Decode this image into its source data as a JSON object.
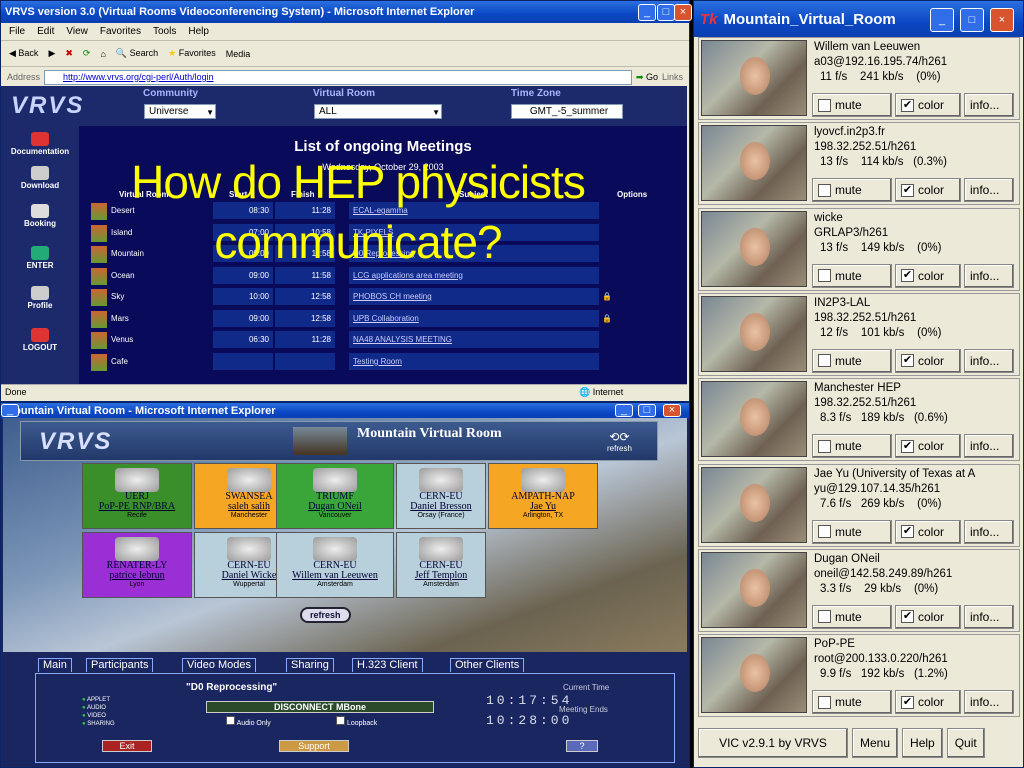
{
  "browser1": {
    "title": "VRVS version 3.0 (Virtual Rooms Videoconferencing System) - Microsoft Internet Explorer",
    "menu": [
      "File",
      "Edit",
      "View",
      "Favorites",
      "Tools",
      "Help"
    ],
    "toolbar": [
      "Back",
      "Search",
      "Favorites",
      "Media"
    ],
    "address_label": "Address",
    "url": "http://www.vrvs.org/cgi-perl/Auth/login",
    "go": "Go",
    "links": "Links",
    "status_left": "Done",
    "status_right": "Internet"
  },
  "vrvs_header": {
    "logo": "VRVS",
    "community_label": "Community",
    "community_value": "Universe",
    "vroom_label": "Virtual Room",
    "vroom_value": "ALL",
    "tz_label": "Time Zone",
    "tz_value": "GMT_-5_summer"
  },
  "sidebar": [
    "Documentation",
    "Download",
    "Booking",
    "ENTER",
    "Profile",
    "LOGOUT"
  ],
  "meetings": {
    "title": "List of ongoing Meetings",
    "date": "Wednesday, October 29, 2003",
    "headers": [
      "Virtual Room",
      "Start",
      "Finish",
      "Subject",
      "Options"
    ],
    "rows": [
      {
        "room": "Desert",
        "start": "08:30",
        "finish": "11:28",
        "subject": "ECAL-egamma"
      },
      {
        "room": "Island",
        "start": "07:00",
        "finish": "10:58",
        "subject": "TK PIXELS"
      },
      {
        "room": "Mountain",
        "start": "09:00",
        "finish": "11:58",
        "subject": "D0 Reprocessing"
      },
      {
        "room": "Ocean",
        "start": "09:00",
        "finish": "11:58",
        "subject": "LCG applications area meeting"
      },
      {
        "room": "Sky",
        "start": "10:00",
        "finish": "12:58",
        "subject": "PHOBOS CH meeting"
      },
      {
        "room": "Mars",
        "start": "09:00",
        "finish": "12:58",
        "subject": "UPB Collaboration"
      },
      {
        "room": "Venus",
        "start": "06:30",
        "finish": "11:28",
        "subject": "NA48 ANALYSIS MEETING"
      },
      {
        "room": "Cafe",
        "start": "",
        "finish": "",
        "subject": "Testing Room"
      }
    ]
  },
  "overlay_text": [
    "How do HEP physicists",
    "communicate?"
  ],
  "browser2": {
    "title": "Mountain Virtual Room - Microsoft Internet Explorer",
    "logo": "VRVS",
    "room_title": "Mountain Virtual Room",
    "refresh": "refresh",
    "sites": [
      {
        "name": "UERJ",
        "sub1": "PoP-PE RNP/BRA",
        "sub2": "Recife",
        "color": "#3a8f2a"
      },
      {
        "name": "SWANSEA",
        "sub1": "saleh salih",
        "sub2": "Manchester",
        "color": "#f5a623"
      },
      {
        "name": "TRIUMF",
        "sub1": "Dugan ONeil",
        "sub2": "Vancouver",
        "color": "#3aa63a"
      },
      {
        "name": "CERN-EU",
        "sub1": "Daniel Bresson",
        "sub2": "Orsay (France)",
        "color": "#b8cfdc"
      },
      {
        "name": "AMPATH-NAP",
        "sub1": "Jae Yu",
        "sub2": "Arlington, TX",
        "color": "#f5a623"
      },
      {
        "name": "RENATER-LY",
        "sub1": "patrice lebrun",
        "sub2": "Lyon",
        "color": "#9b2fd6"
      },
      {
        "name": "CERN-EU",
        "sub1": "Daniel Wicke",
        "sub2": "Wuppertal",
        "color": "#b8cfdc"
      },
      {
        "name": "CERN-EU",
        "sub1": "Willem van Leeuwen",
        "sub2": "Amsterdam",
        "color": "#b8cfdc"
      },
      {
        "name": "CERN-EU",
        "sub1": "Jeff Templon",
        "sub2": "Amsterdam",
        "color": "#b8cfdc"
      }
    ],
    "tabs": [
      "Main",
      "Participants",
      "Video Modes",
      "Sharing",
      "H.323 Client",
      "Other Clients"
    ],
    "session": "\"D0 Reprocessing\"",
    "legend": [
      "APPLET",
      "AUDIO",
      "VIDEO",
      "SHARING"
    ],
    "disconnect": "DISCONNECT MBone",
    "audio_only": "Audio Only",
    "loopback": "Loopback",
    "current_time_label": "Current Time",
    "current_time": "10:17:54",
    "ends_label": "Meeting Ends",
    "ends_time": "10:28:00",
    "exit": "Exit",
    "support": "Support",
    "help": "?"
  },
  "vic": {
    "title": "Mountain_Virtual_Room",
    "participants": [
      {
        "name": "Willem van Leeuwen",
        "addr": "a03@192.16.195.74/h261",
        "stats": "11 f/s    241 kb/s    (0%)"
      },
      {
        "name": "lyovcf.in2p3.fr",
        "addr": "198.32.252.51/h261",
        "stats": "13 f/s    114 kb/s   (0.3%)"
      },
      {
        "name": "wicke",
        "addr": "GRLAP3/h261",
        "stats": "13 f/s    149 kb/s    (0%)"
      },
      {
        "name": "IN2P3-LAL",
        "addr": "198.32.252.51/h261",
        "stats": "12 f/s    101 kb/s    (0%)"
      },
      {
        "name": "Manchester HEP",
        "addr": "198.32.252.51/h261",
        "stats": "8.3 f/s   189 kb/s   (0.6%)"
      },
      {
        "name": "Jae Yu (University of Texas at A",
        "addr": "yu@129.107.14.35/h261",
        "stats": "7.6 f/s   269 kb/s    (0%)"
      },
      {
        "name": "Dugan ONeil",
        "addr": "oneil@142.58.249.89/h261",
        "stats": "3.3 f/s    29 kb/s    (0%)"
      },
      {
        "name": "PoP-PE",
        "addr": "root@200.133.0.220/h261",
        "stats": "9.9 f/s   192 kb/s   (1.2%)"
      }
    ],
    "mute": "mute",
    "color": "color",
    "info": "info...",
    "version": "VIC v2.9.1 by VRVS",
    "menu": "Menu",
    "help": "Help",
    "quit": "Quit"
  }
}
